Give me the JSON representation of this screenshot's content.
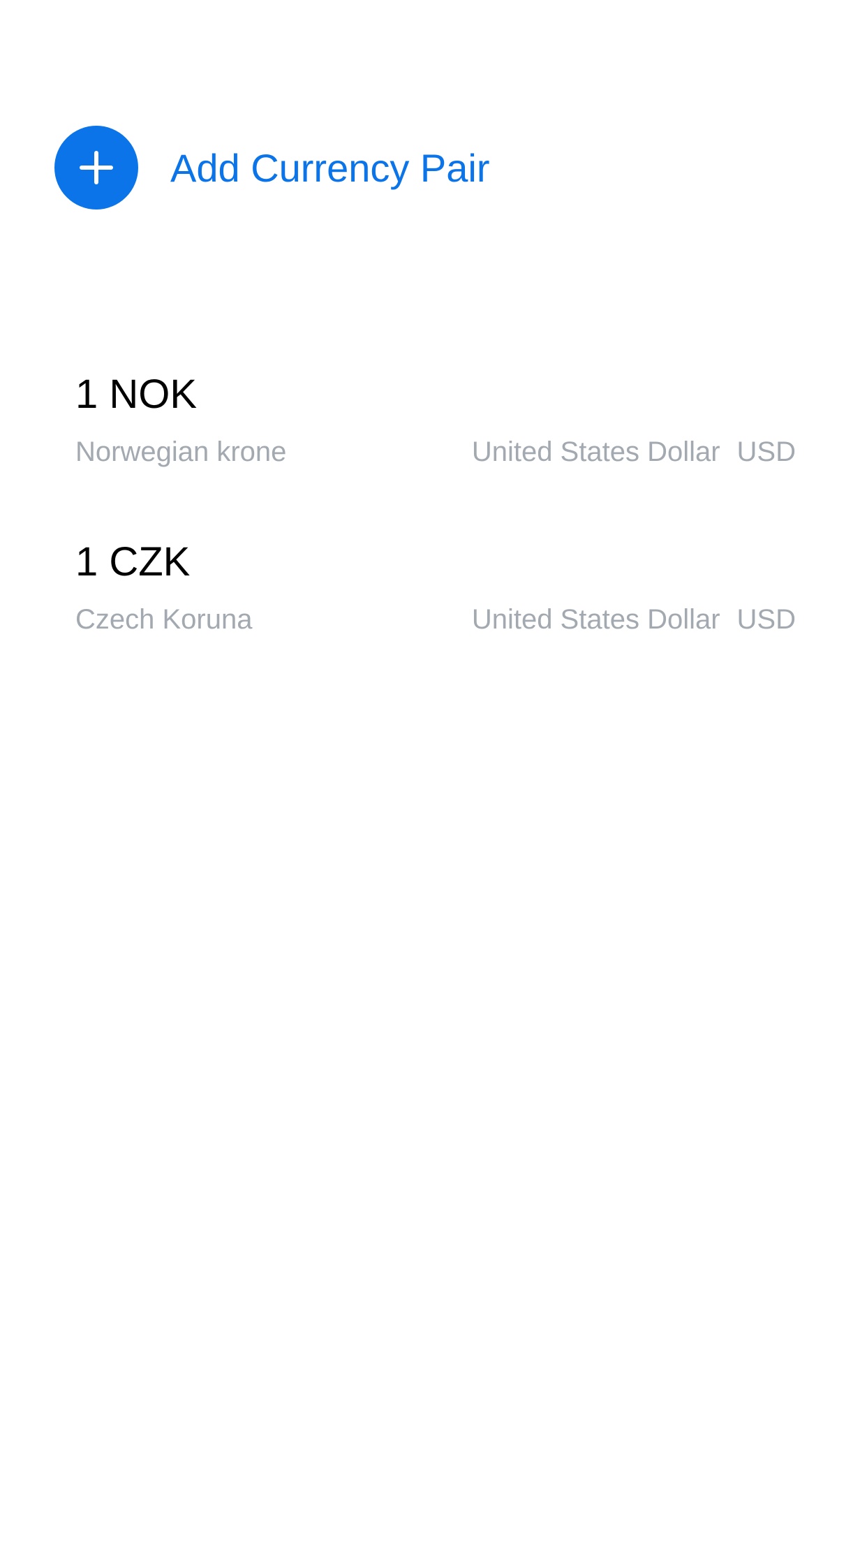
{
  "add_pair": {
    "label": "Add Currency Pair",
    "icon": "plus-icon"
  },
  "colors": {
    "accent": "#0a74e8",
    "primary_text": "#000000",
    "secondary_text": "#a3a9b0",
    "background": "#ffffff"
  },
  "pairs": [
    {
      "amount": "1 NOK",
      "from_name": "Norwegian krone",
      "to_name": "United States Dollar",
      "to_code": "USD"
    },
    {
      "amount": "1 CZK",
      "from_name": "Czech Koruna",
      "to_name": "United States Dollar",
      "to_code": "USD"
    }
  ]
}
